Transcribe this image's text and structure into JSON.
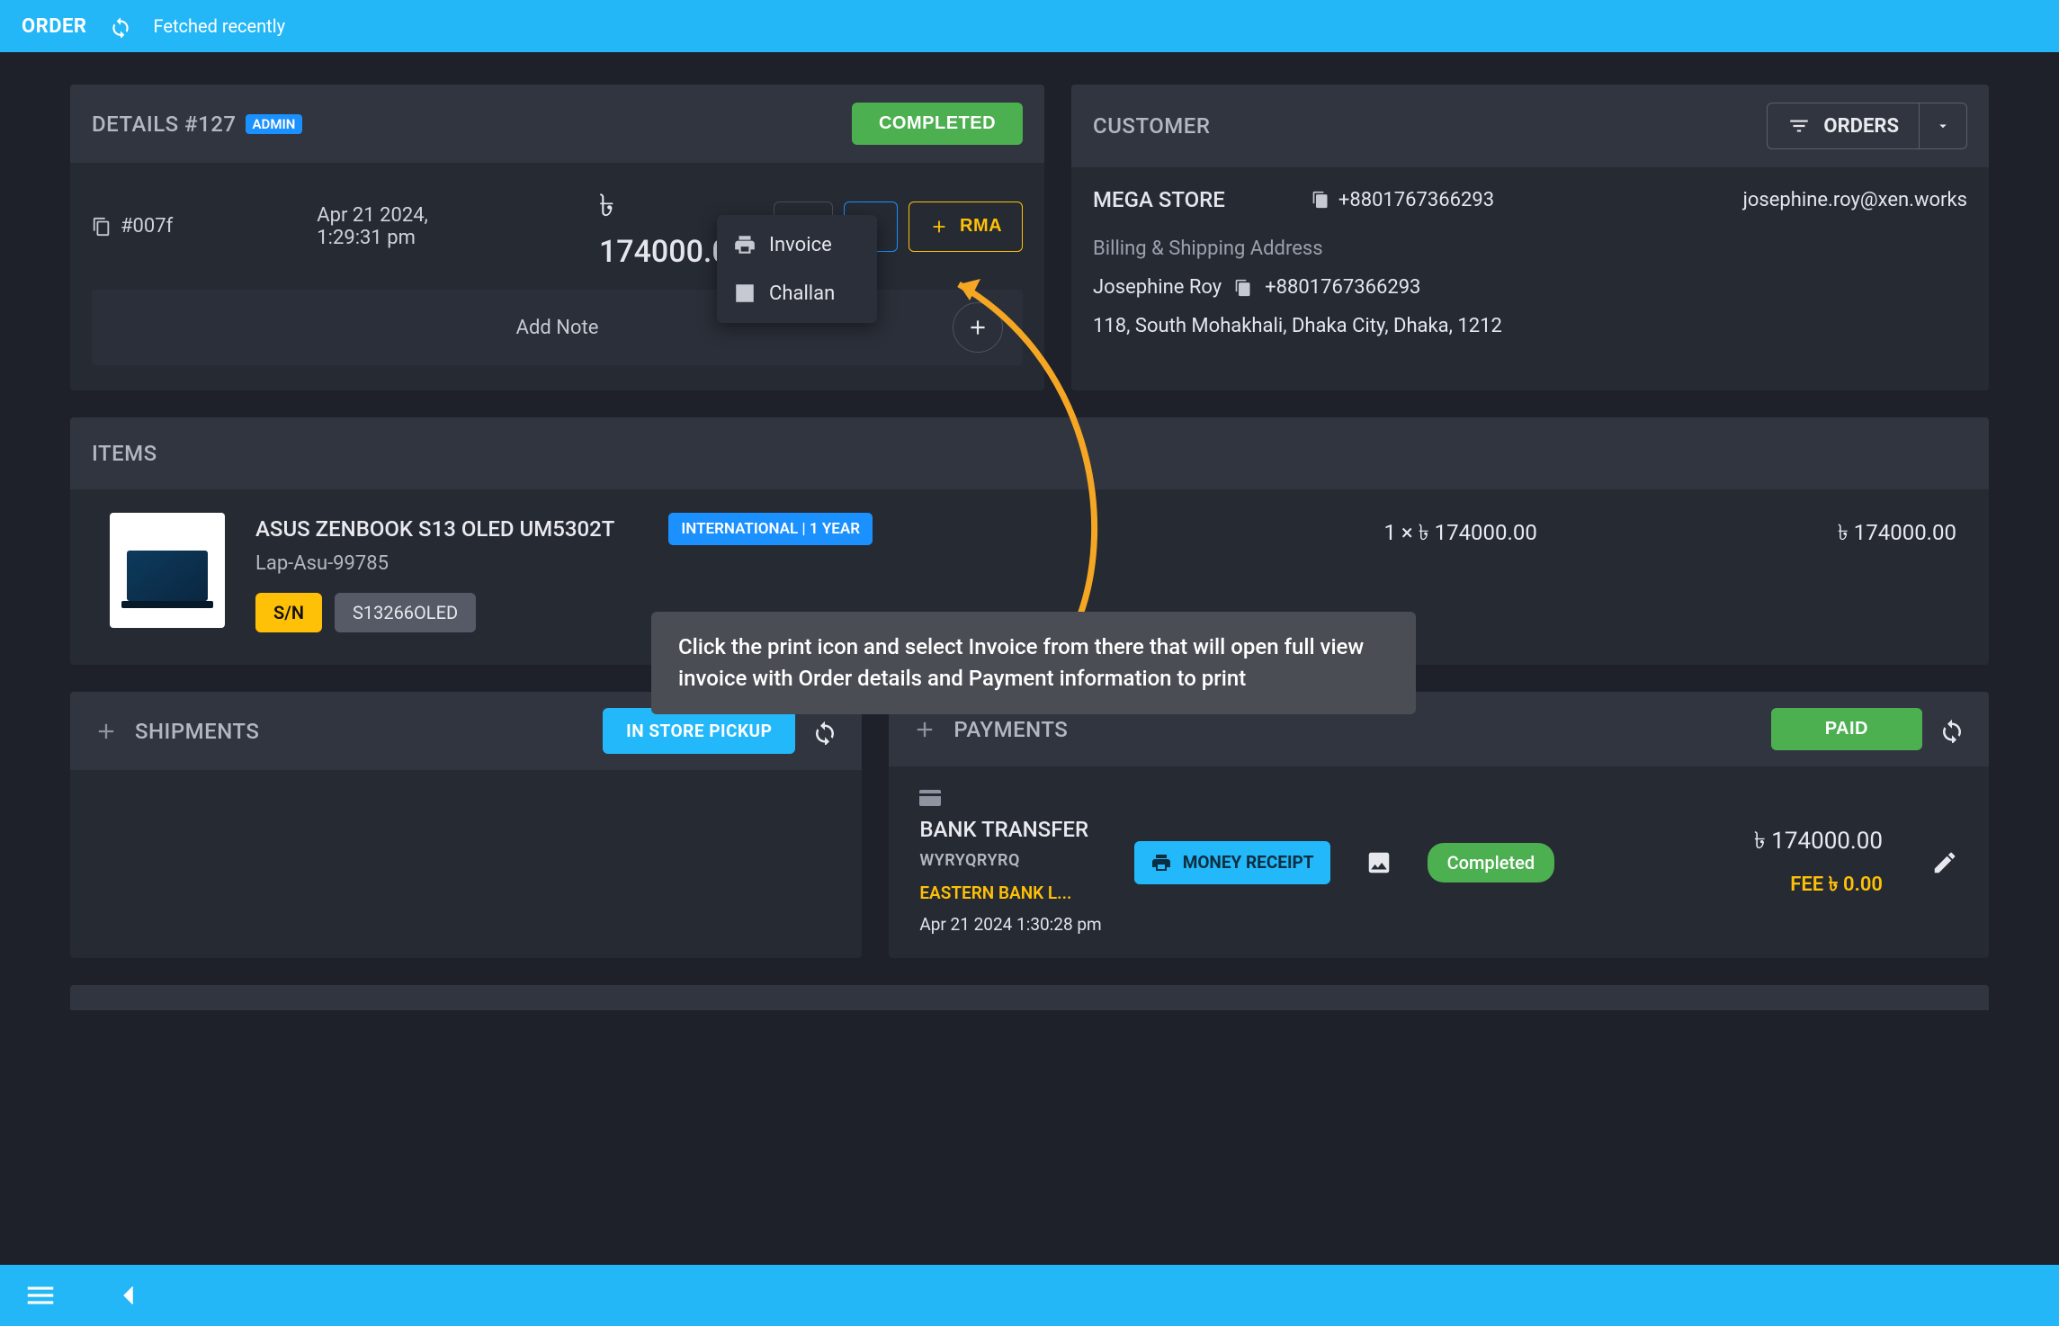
{
  "topbar": {
    "title": "ORDER",
    "fetched": "Fetched recently"
  },
  "details": {
    "title": "DETAILS #127",
    "badge": "ADMIN",
    "status_btn": "COMPLETED",
    "copy_id": "#007f",
    "timestamp": "Apr 21 2024, 1:29:31 pm",
    "amount": "৳ 174000.00",
    "rma_btn": "RMA",
    "add_note": "Add Note",
    "print_menu": {
      "invoice": "Invoice",
      "challan": "Challan"
    }
  },
  "customer": {
    "title": "CUSTOMER",
    "orders_btn": "ORDERS",
    "store": "MEGA STORE",
    "phone1": "+8801767366293",
    "email": "josephine.roy@xen.works",
    "addr_label": "Billing & Shipping Address",
    "name": "Josephine Roy",
    "phone2": "+8801767366293",
    "address": "118, South Mohakhali, Dhaka City, Dhaka, 1212"
  },
  "items": {
    "title": "ITEMS",
    "item": {
      "name": "ASUS ZENBOOK S13 OLED UM5302T",
      "sku": "Lap-Asu-99785",
      "warranty": "INTERNATIONAL | 1 YEAR",
      "sn_label": "S/N",
      "sn": "S13266OLED",
      "qty": "1 × ৳ 174000.00",
      "line_total": "৳ 174000.00"
    }
  },
  "shipments": {
    "title": "SHIPMENTS",
    "pill": "IN STORE PICKUP"
  },
  "payments": {
    "title": "PAYMENTS",
    "status_btn": "PAID",
    "method": "BANK TRANSFER",
    "txn": "WYRYQRYRQ",
    "bank": "EASTERN BANK L...",
    "ts": "Apr 21 2024 1:30:28 pm",
    "money_receipt": "MONEY RECEIPT",
    "chip": "Completed",
    "amount": "৳ 174000.00",
    "fee": "FEE ৳ 0.00"
  },
  "annotation": "Click the print icon and select Invoice from there that will open full view invoice with Order details and Payment information to print"
}
